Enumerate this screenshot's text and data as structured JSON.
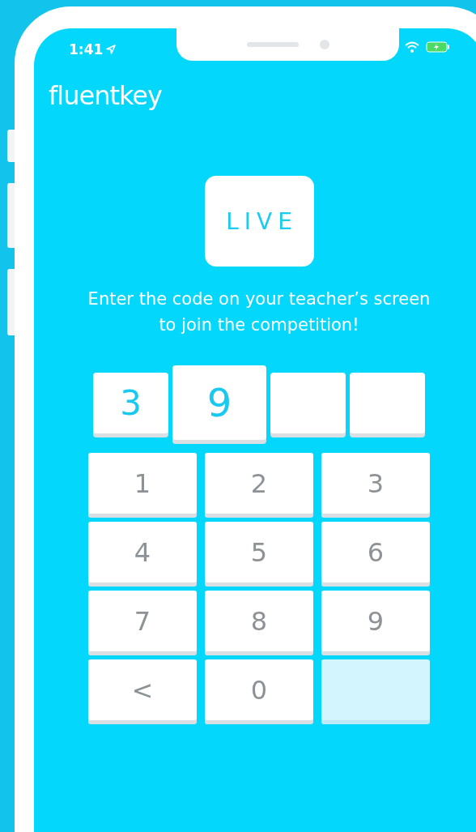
{
  "status_bar": {
    "time": "1:41"
  },
  "logo": "fluentkey",
  "live_badge": "LIVE",
  "instruction": "Enter the code on your teacher’s screen to join the competition!",
  "code_slots": [
    {
      "digit": "3",
      "selected": false
    },
    {
      "digit": "9",
      "selected": true
    },
    {
      "selected": false
    },
    {
      "selected": false
    }
  ],
  "keypad": [
    {
      "kind": "digit",
      "label": "1"
    },
    {
      "kind": "digit",
      "label": "2"
    },
    {
      "kind": "digit",
      "label": "3"
    },
    {
      "kind": "digit",
      "label": "4"
    },
    {
      "kind": "digit",
      "label": "5"
    },
    {
      "kind": "digit",
      "label": "6"
    },
    {
      "kind": "digit",
      "label": "7"
    },
    {
      "kind": "digit",
      "label": "8"
    },
    {
      "kind": "digit",
      "label": "9"
    },
    {
      "kind": "back",
      "label": "<"
    },
    {
      "kind": "digit",
      "label": "0"
    },
    {
      "kind": "blank"
    }
  ]
}
